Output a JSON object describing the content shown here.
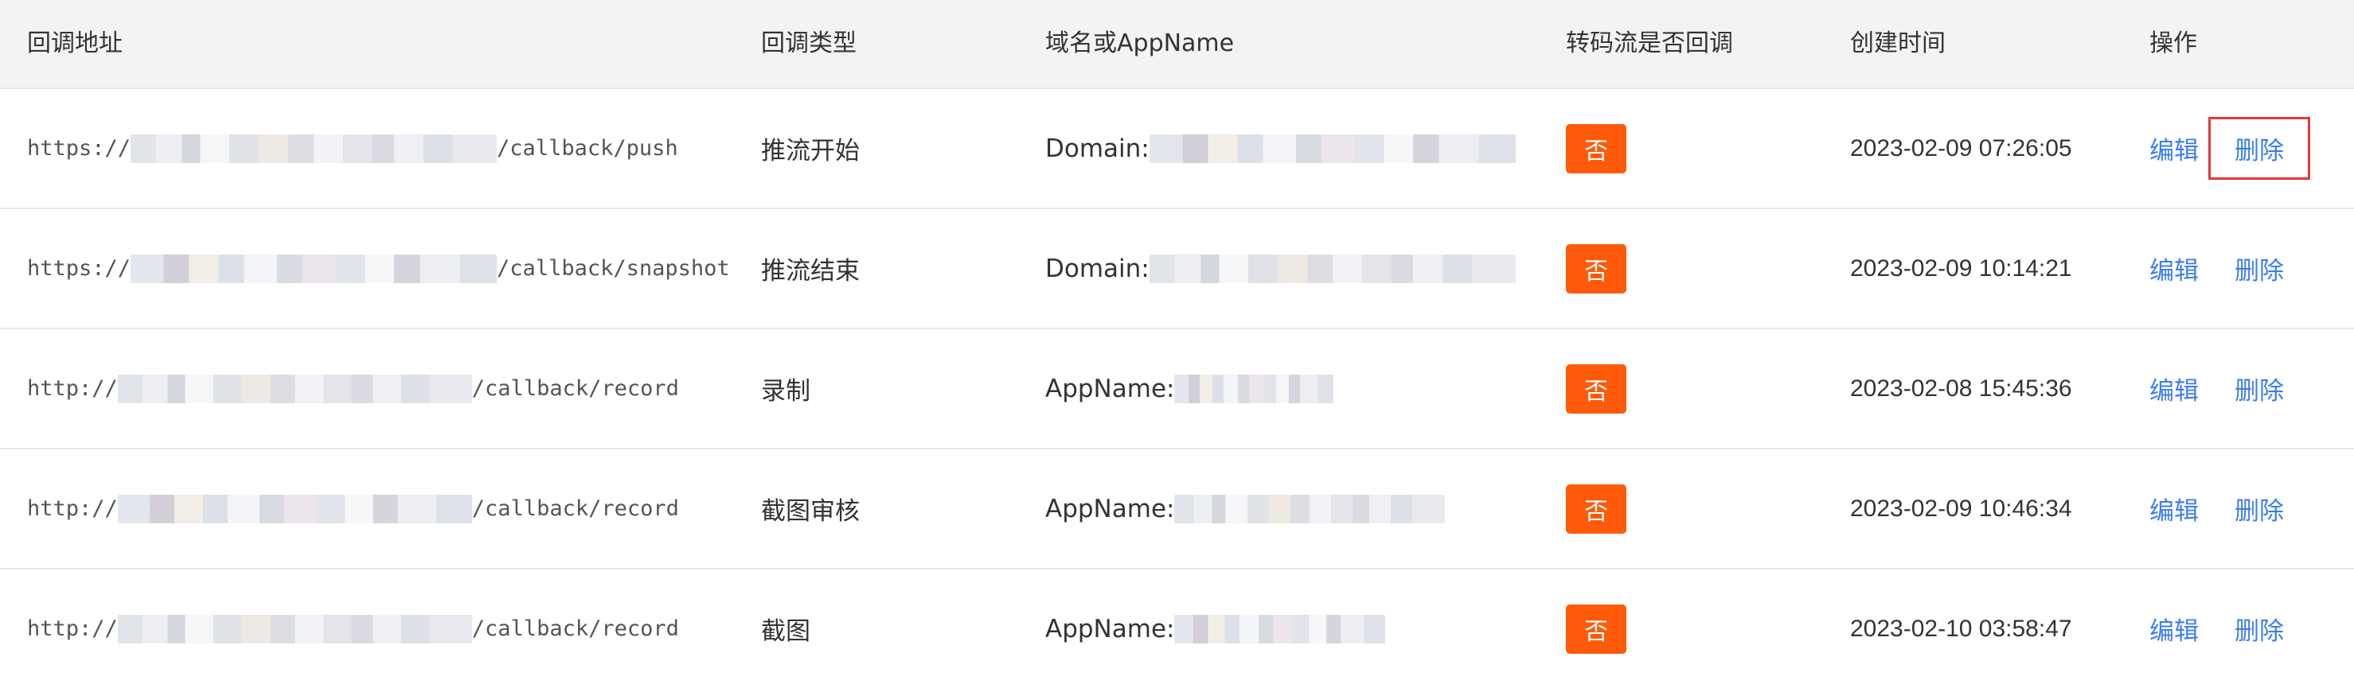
{
  "columns": {
    "url": "回调地址",
    "type": "回调类型",
    "domain": "域名或AppName",
    "transcode": "转码流是否回调",
    "created": "创建时间",
    "ops": "操作"
  },
  "rows": [
    {
      "url_prefix": "https://",
      "url_suffix": "/callback/push",
      "type": "推流开始",
      "domain_label": "Domain:",
      "transcode": "否",
      "created": "2023-02-09 07:26:05",
      "edit": "编辑",
      "delete": "删除"
    },
    {
      "url_prefix": "https://",
      "url_suffix": "/callback/snapshot",
      "type": "推流结束",
      "domain_label": "Domain:",
      "transcode": "否",
      "created": "2023-02-09 10:14:21",
      "edit": "编辑",
      "delete": "删除"
    },
    {
      "url_prefix": "http://",
      "url_suffix": "/callback/record",
      "type": "录制",
      "domain_label": "AppName:",
      "transcode": "否",
      "created": "2023-02-08 15:45:36",
      "edit": "编辑",
      "delete": "删除"
    },
    {
      "url_prefix": "http://",
      "url_suffix": "/callback/record",
      "type": "截图审核",
      "domain_label": "AppName:",
      "transcode": "否",
      "created": "2023-02-09 10:46:34",
      "edit": "编辑",
      "delete": "删除"
    },
    {
      "url_prefix": "http://",
      "url_suffix": "/callback/record",
      "type": "截图",
      "domain_label": "AppName:",
      "transcode": "否",
      "created": "2023-02-10 03:58:47",
      "edit": "编辑",
      "delete": "删除"
    }
  ],
  "colors": {
    "header_bg": "#f2f3f5",
    "badge_bg": "#ff5a0a",
    "link": "#3b7df0",
    "highlight_outline": "#e0393e"
  }
}
